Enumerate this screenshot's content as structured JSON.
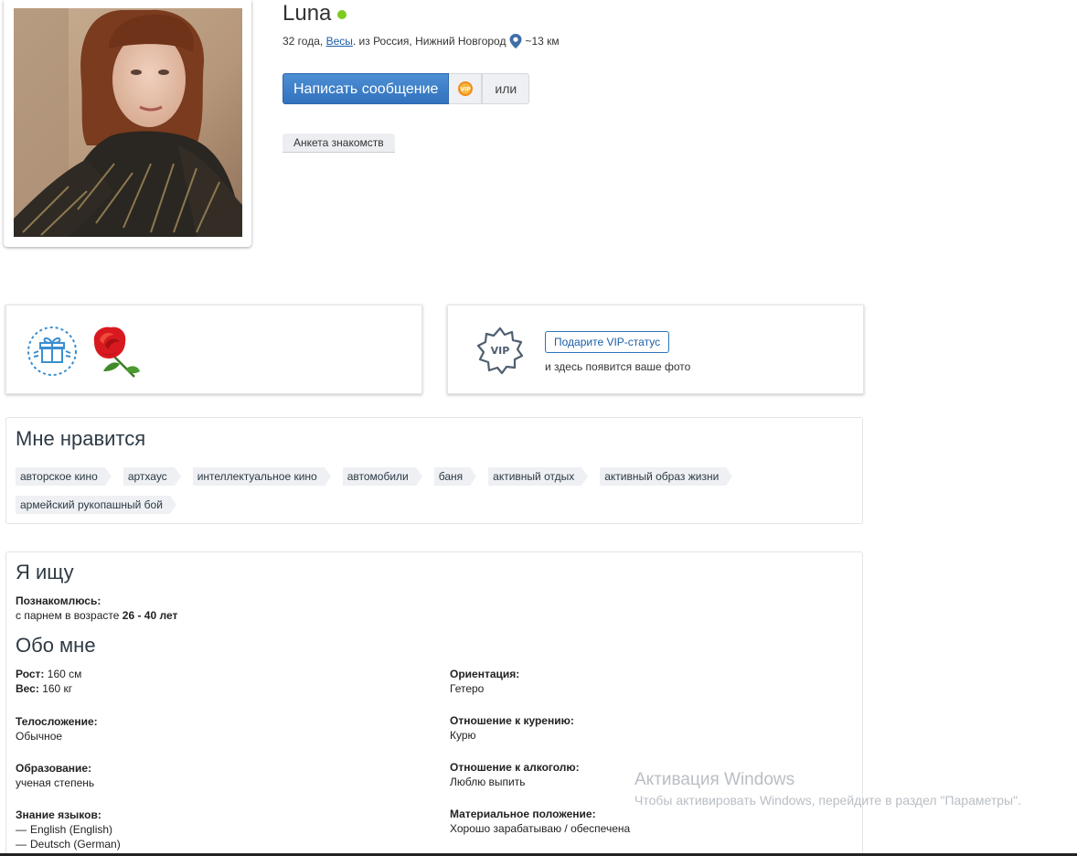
{
  "profile": {
    "name": "Luna",
    "age": "32 года,",
    "zodiac": "Весы",
    "location": ". из Россия, Нижний Новгород",
    "distance": "~13 км",
    "online_color": "#7ccb1f"
  },
  "actions": {
    "message_label": "Написать сообщение",
    "vip_icon": "vip-badge-icon",
    "or_label": "или",
    "profile_tag": "Анкета знакомств"
  },
  "gifts": {
    "gift_icon": "gift-icon",
    "items": [
      "rose"
    ]
  },
  "vip": {
    "icon_text": "VIP",
    "button_label": "Подарите VIP-статус",
    "note": "и здесь появится ваше фото"
  },
  "likes": {
    "title": "Мне нравится",
    "items": [
      "авторское кино",
      "артхаус",
      "интеллектуальное кино",
      "автомобили",
      "баня",
      "активный отдых",
      "активный образ жизни",
      "армейский рукопашный бой"
    ]
  },
  "search": {
    "title": "Я ищу",
    "meet_label": "Познакомлюсь:",
    "meet_text": "с парнем в возрасте",
    "age_range": "26 - 40 лет"
  },
  "about": {
    "title": "Обо мне",
    "height_label": "Рост:",
    "height_value": "160 см",
    "weight_label": "Вес:",
    "weight_value": "160 кг",
    "build_label": "Телосложение:",
    "build_value": "Обычное",
    "education_label": "Образование:",
    "education_value": "ученая степень",
    "languages_label": "Знание языков:",
    "languages": [
      "English (English)",
      "Deutsch (German)"
    ],
    "orientation_label": "Ориентация:",
    "orientation_value": "Гетеро",
    "smoking_label": "Отношение к курению:",
    "smoking_value": "Курю",
    "alcohol_label": "Отношение к алкоголю:",
    "alcohol_value": "Люблю выпить",
    "finance_label": "Материальное положение:",
    "finance_value": "Хорошо зарабатываю / обеспечена"
  },
  "watermark": {
    "title": "Активация Windows",
    "subtitle": "Чтобы активировать Windows, перейдите в раздел \"Параметры\"."
  },
  "colors": {
    "accent": "#3272bf",
    "link": "#1a5ea8",
    "chip_bg": "#eef0f3"
  }
}
